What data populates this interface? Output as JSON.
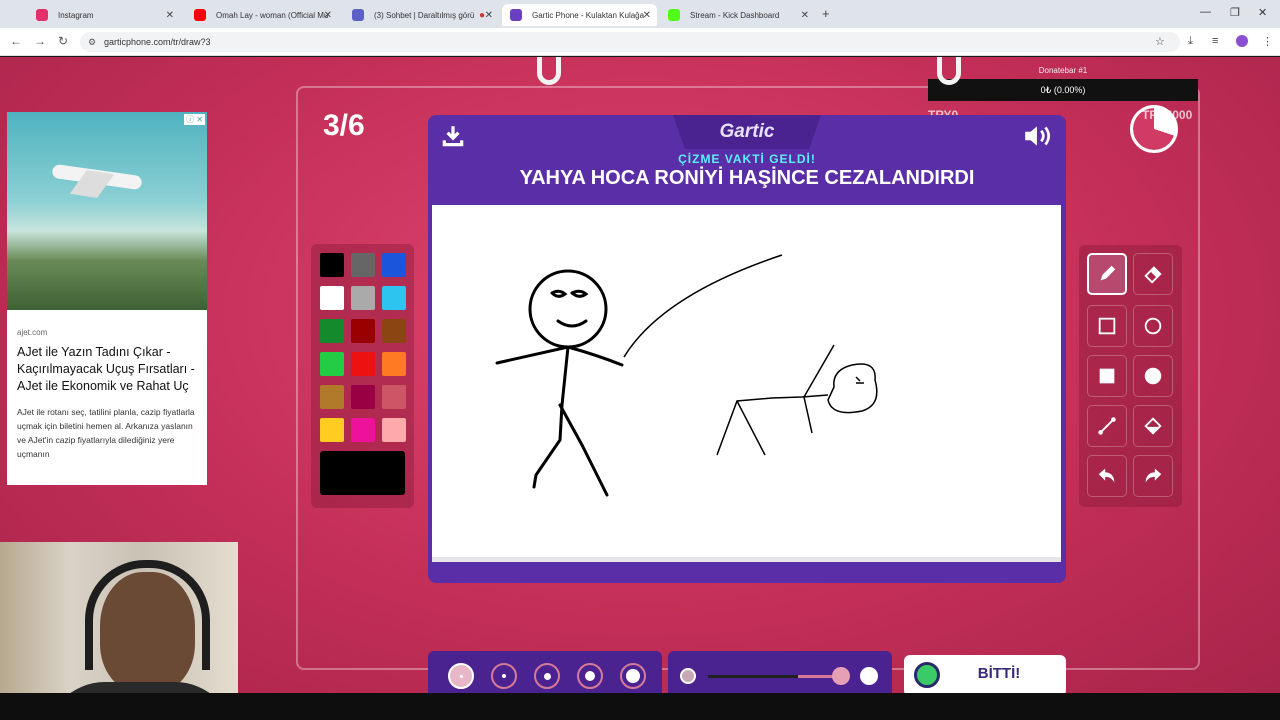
{
  "browser": {
    "tabs": [
      {
        "label": "Instagram",
        "color": "#e1306c"
      },
      {
        "label": "Omah Lay - woman (Official Mu",
        "color": "#ff0000"
      },
      {
        "label": "(3) Sohbet | Daraltılmış görü",
        "color": "#5b5fc7"
      },
      {
        "label": "Gartic Phone - Kulaktan Kulağa",
        "color": "#6a3fc2"
      },
      {
        "label": "Stream - Kick Dashboard",
        "color": "#53fc18"
      }
    ],
    "active_tab": 3,
    "url": "garticphone.com/tr/draw?3"
  },
  "overlay": {
    "donate_label": "Donatebar #1",
    "donate_value": "0₺ (0.00%)",
    "try_left": "TRY0",
    "try_right": "TRY5000"
  },
  "game": {
    "round": "3/6",
    "logo": "Gartic",
    "subtitle": "ÇİZME VAKTİ GELDİ!",
    "prompt": "YAHYA HOCA RONİYİ HAŞİNCE CEZALANDIRDI",
    "done_label": "BİTTİ!",
    "opacity_value": 0.9,
    "timer_remaining": 0.3,
    "colors": [
      "#000000",
      "#666666",
      "#1a56db",
      "#ffffff",
      "#aaaaaa",
      "#2ec4f0",
      "#148a2c",
      "#990000",
      "#8b4513",
      "#22cc44",
      "#ee1111",
      "#ff7a22",
      "#b07a2a",
      "#990044",
      "#cc5566",
      "#ffcc22",
      "#ee1199",
      "#ffaaaa"
    ],
    "current_color": "#000000",
    "tools": [
      "pen-icon",
      "eraser-icon",
      "rectangle-outline-icon",
      "circle-outline-icon",
      "rectangle-filled-icon",
      "circle-filled-icon",
      "line-icon",
      "fill-bucket-icon",
      "undo-icon",
      "redo-icon"
    ]
  },
  "ad": {
    "domain": "ajet.com",
    "title": "AJet ile Yazın Tadını Çıkar - Kaçırılmayacak Uçuş Fırsatları - AJet ile Ekonomik ve Rahat Uç",
    "body": "AJet ile rotanı seç, tatilini planla, cazip fiyatlarla uçmak için biletini hemen al. Arkanıza yaslanın ve AJet'in cazip fiyatlarıyla dilediğiniz yere uçmanın"
  }
}
